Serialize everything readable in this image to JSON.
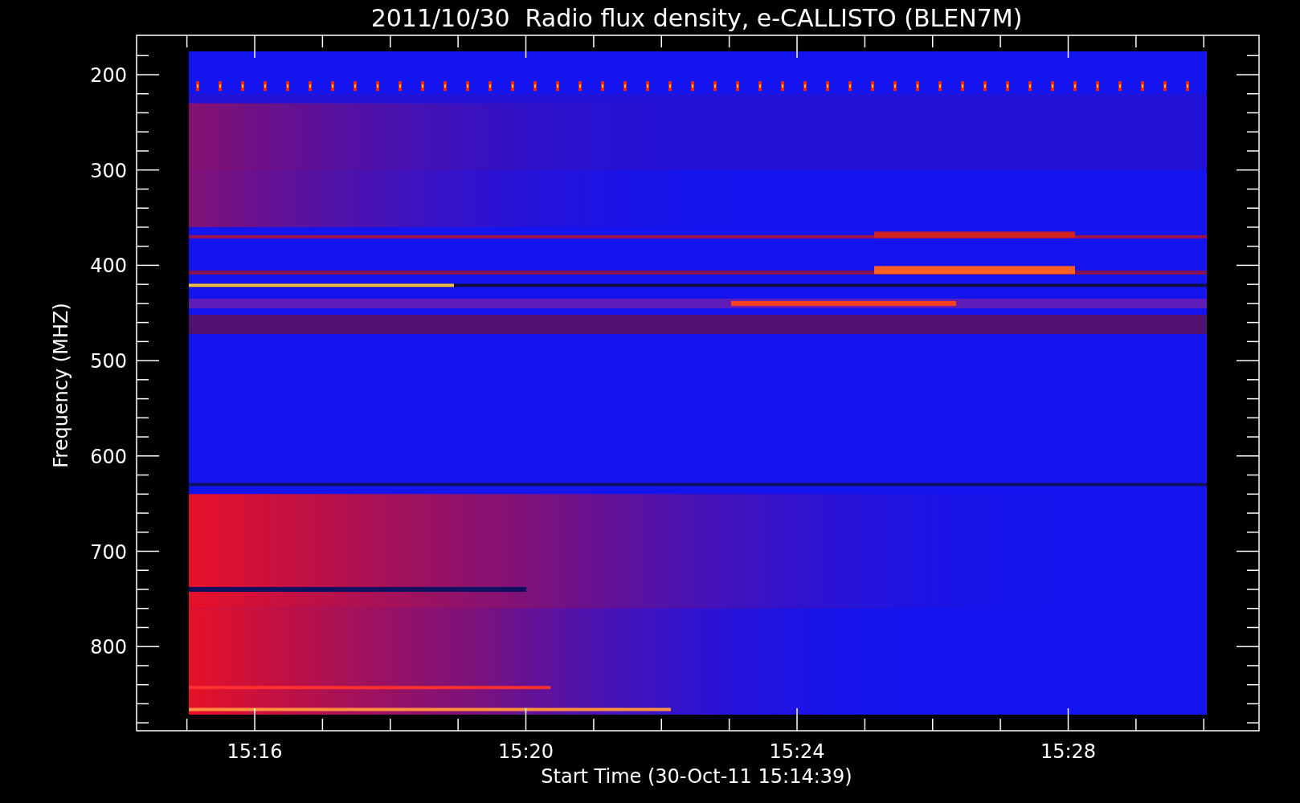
{
  "title": "2011/10/30  Radio flux density, e-CALLISTO (BLEN7M)",
  "y_axis": {
    "label": "Frequency (MHZ)",
    "ticks": [
      "200",
      "300",
      "400",
      "500",
      "600",
      "700",
      "800"
    ]
  },
  "x_axis": {
    "label": "Start Time (30-Oct-11 15:14:39)",
    "ticks": [
      "15:16",
      "15:20",
      "15:24",
      "15:28"
    ]
  }
}
